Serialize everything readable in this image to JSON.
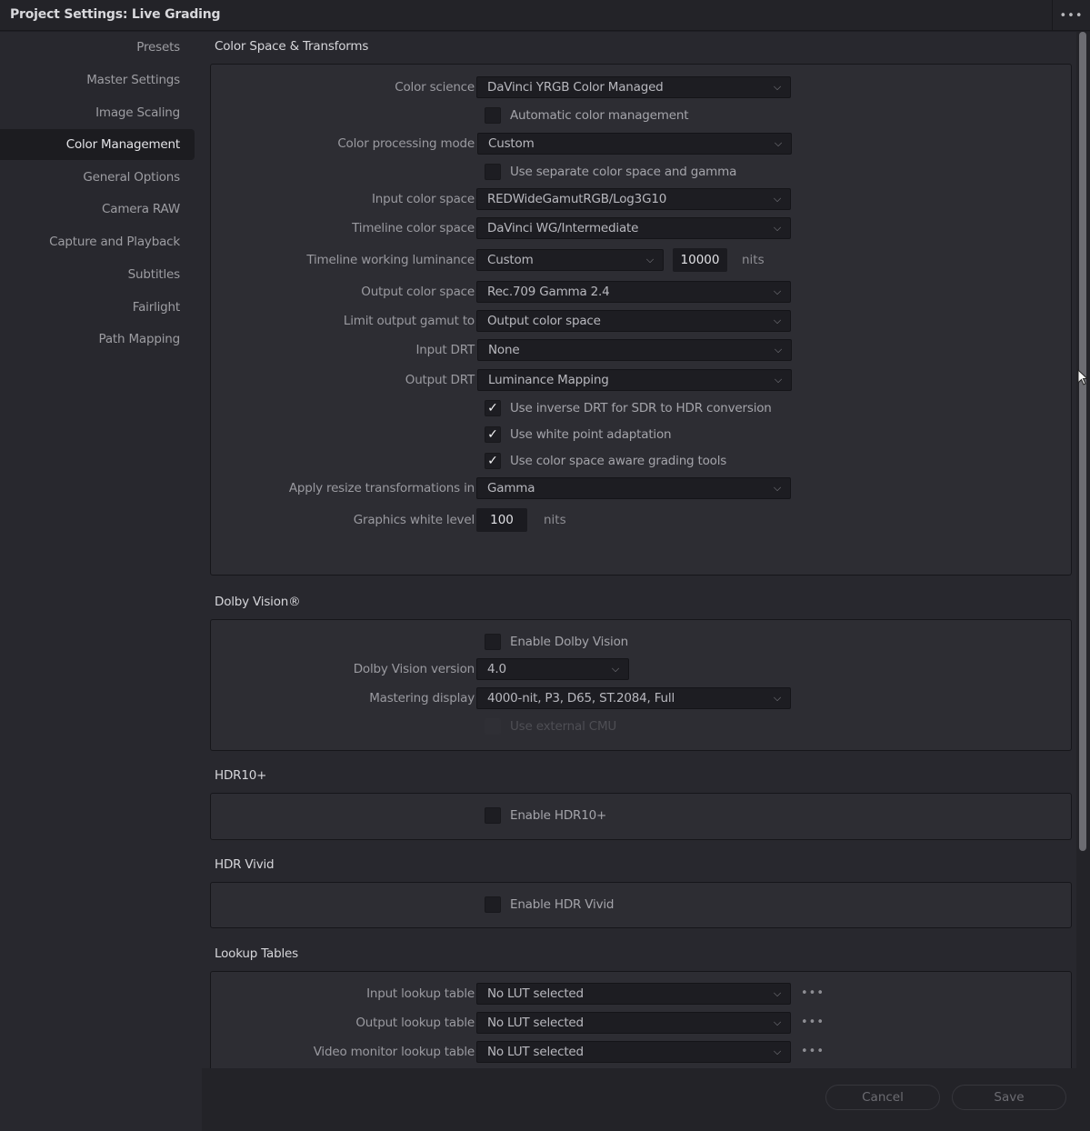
{
  "window": {
    "title": "Project Settings:  Live Grading",
    "menu_icon": "ellipsis-icon",
    "menu_glyph": "•••"
  },
  "sidebar": {
    "items": [
      {
        "label": "Presets",
        "active": false
      },
      {
        "label": "Master Settings",
        "active": false
      },
      {
        "label": "Image Scaling",
        "active": false
      },
      {
        "label": "Color Management",
        "active": true
      },
      {
        "label": "General Options",
        "active": false
      },
      {
        "label": "Camera RAW",
        "active": false
      },
      {
        "label": "Capture and Playback",
        "active": false
      },
      {
        "label": "Subtitles",
        "active": false
      },
      {
        "label": "Fairlight",
        "active": false
      },
      {
        "label": "Path Mapping",
        "active": false
      }
    ]
  },
  "color_space": {
    "title": "Color Space & Transforms",
    "color_science": {
      "label": "Color science",
      "value": "DaVinci YRGB Color Managed"
    },
    "automatic_cm": {
      "label": "Automatic color management",
      "checked": false
    },
    "processing_mode": {
      "label": "Color processing mode",
      "value": "Custom"
    },
    "separate_space_gamma": {
      "label": "Use separate color space and gamma",
      "checked": false
    },
    "input_color_space": {
      "label": "Input color space",
      "value": "REDWideGamutRGB/Log3G10"
    },
    "timeline_color_space": {
      "label": "Timeline color space",
      "value": "DaVinci WG/Intermediate"
    },
    "timeline_luminance": {
      "label": "Timeline working luminance",
      "value": "Custom",
      "nits": "10000",
      "unit": "nits"
    },
    "output_color_space": {
      "label": "Output color space",
      "value": "Rec.709 Gamma 2.4"
    },
    "limit_output_gamut": {
      "label": "Limit output gamut to",
      "value": "Output color space"
    },
    "input_drt": {
      "label": "Input DRT",
      "value": "None"
    },
    "output_drt": {
      "label": "Output DRT",
      "value": "Luminance Mapping"
    },
    "inverse_drt": {
      "label": "Use inverse DRT for SDR to HDR conversion",
      "checked": true
    },
    "white_point": {
      "label": "Use white point adaptation",
      "checked": true
    },
    "aware_tools": {
      "label": "Use color space aware grading tools",
      "checked": true
    },
    "resize_transform": {
      "label": "Apply resize transformations in",
      "value": "Gamma"
    },
    "graphics_white": {
      "label": "Graphics white level",
      "value": "100",
      "unit": "nits"
    }
  },
  "dolby": {
    "title": "Dolby Vision®",
    "enable": {
      "label": "Enable Dolby Vision",
      "checked": false
    },
    "version": {
      "label": "Dolby Vision version",
      "value": "4.0"
    },
    "mastering_display": {
      "label": "Mastering display",
      "value": "4000-nit, P3, D65, ST.2084, Full"
    },
    "external_cmu": {
      "label": "Use external CMU",
      "checked": false,
      "disabled": true
    }
  },
  "hdr10": {
    "title": "HDR10+",
    "enable": {
      "label": "Enable HDR10+",
      "checked": false
    }
  },
  "hdr_vivid": {
    "title": "HDR Vivid",
    "enable": {
      "label": "Enable HDR Vivid",
      "checked": false
    }
  },
  "luts": {
    "title": "Lookup Tables",
    "items": [
      {
        "label": "Input lookup table",
        "value": "No LUT selected"
      },
      {
        "label": "Output lookup table",
        "value": "No LUT selected"
      },
      {
        "label": "Video monitor lookup table",
        "value": "No LUT selected"
      }
    ],
    "more_glyph": "•••"
  },
  "footer": {
    "cancel_label": "Cancel",
    "save_label": "Save"
  },
  "scroll": {
    "position_fraction": 0.0,
    "visible_fraction": 0.79
  },
  "glyphs": {
    "chevron": "⌵",
    "check": "✓"
  }
}
